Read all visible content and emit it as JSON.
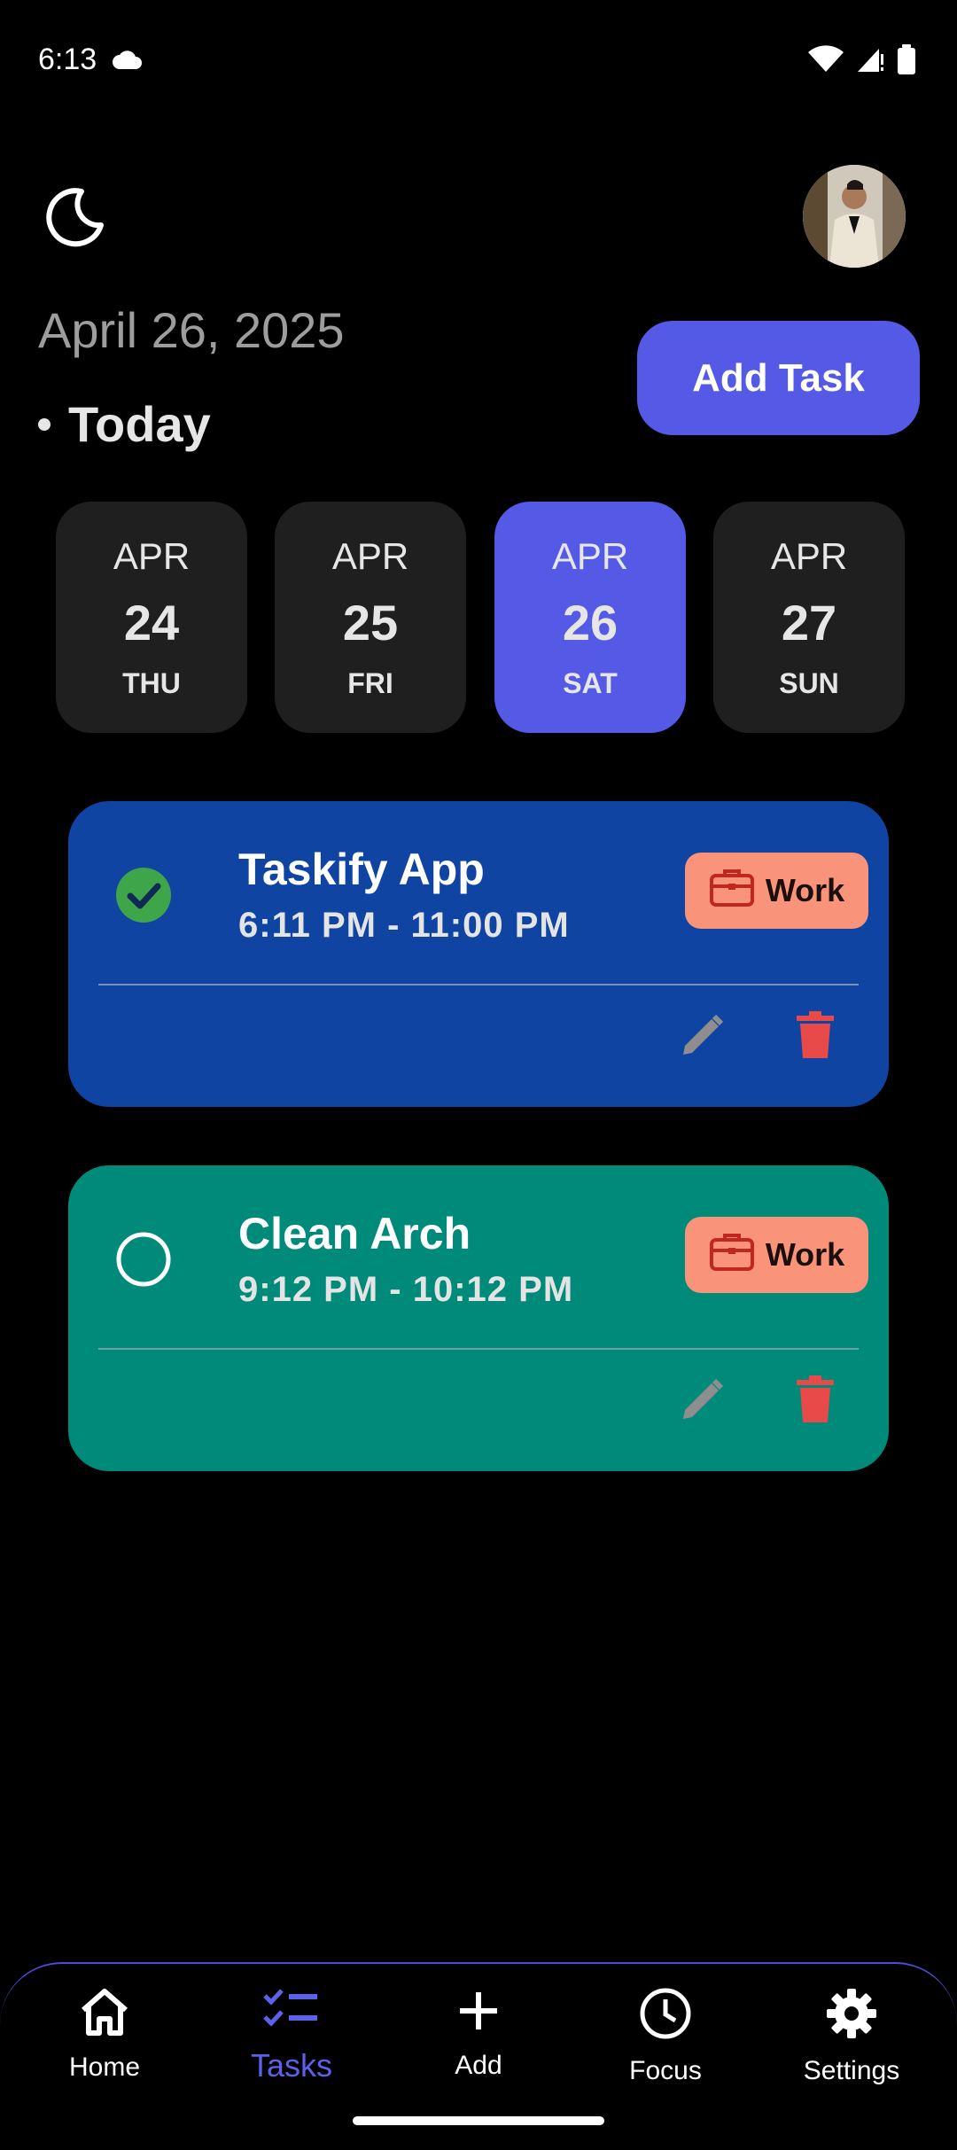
{
  "status_bar": {
    "time": "6:13"
  },
  "header": {
    "date": "April 26, 2025",
    "today_label": "Today",
    "add_task_label": "Add Task"
  },
  "date_chips": [
    {
      "month": "APR",
      "day": "24",
      "weekday": "THU",
      "selected": false
    },
    {
      "month": "APR",
      "day": "25",
      "weekday": "FRI",
      "selected": false
    },
    {
      "month": "APR",
      "day": "26",
      "weekday": "SAT",
      "selected": true
    },
    {
      "month": "APR",
      "day": "27",
      "weekday": "SUN",
      "selected": false
    }
  ],
  "tasks": [
    {
      "title": "Taskify App",
      "time": "6:11 PM - 11:00 PM",
      "category": "Work",
      "completed": true,
      "color": "#0f44a3"
    },
    {
      "title": "Clean Arch",
      "time": "9:12 PM - 10:12 PM",
      "category": "Work",
      "completed": false,
      "color": "#008a7a"
    }
  ],
  "bottom_nav": {
    "items": [
      {
        "label": "Home",
        "icon": "home-icon"
      },
      {
        "label": "Tasks",
        "icon": "tasks-icon",
        "active": true
      },
      {
        "label": "Add",
        "icon": "plus-icon"
      },
      {
        "label": "Focus",
        "icon": "clock-icon"
      },
      {
        "label": "Settings",
        "icon": "gear-icon"
      }
    ]
  },
  "colors": {
    "accent": "#5459e6",
    "chip_bg": "#1f1f1f",
    "badge_bg": "#f9937a",
    "delete_red": "#e84a4a",
    "check_green": "#3fa54a"
  }
}
